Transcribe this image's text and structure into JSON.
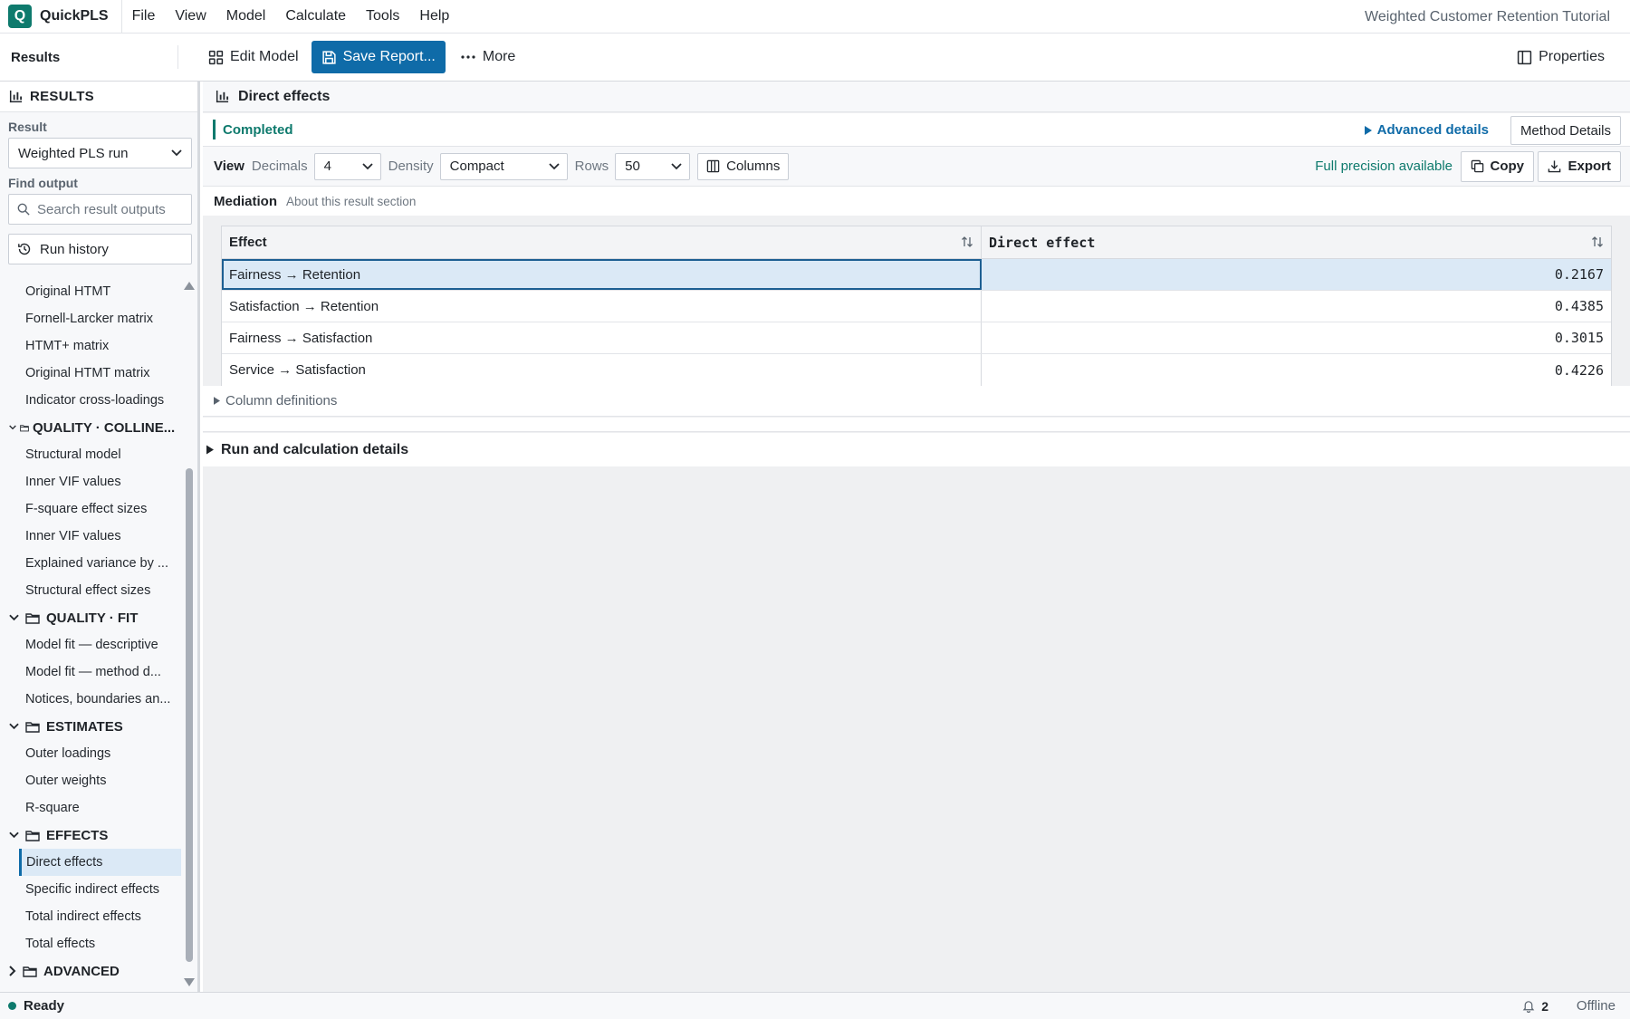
{
  "app": {
    "name": "QuickPLS",
    "logo_letter": "Q",
    "window_title": "Weighted Customer Retention Tutorial",
    "accent": "#0f6ba8",
    "success": "#0e7a6d"
  },
  "menu": [
    "File",
    "View",
    "Model",
    "Calculate",
    "Tools",
    "Help"
  ],
  "toolbar": {
    "title": "Results",
    "edit_model": "Edit Model",
    "save_report": "Save Report...",
    "more": "More",
    "properties": "Properties"
  },
  "sidebar": {
    "header": "RESULTS",
    "result_label": "Result",
    "result_value": "Weighted PLS run",
    "find_label": "Find output",
    "search_placeholder": "Search result outputs",
    "run_history": "Run history",
    "tree": [
      {
        "type": "item",
        "label": "Original HTMT"
      },
      {
        "type": "item",
        "label": "Fornell-Larcker matrix"
      },
      {
        "type": "item",
        "label": "HTMT+ matrix"
      },
      {
        "type": "item",
        "label": "Original HTMT matrix"
      },
      {
        "type": "item",
        "label": "Indicator cross-loadings"
      },
      {
        "type": "group",
        "label": "QUALITY · COLLINE...",
        "expanded": true,
        "small": true
      },
      {
        "type": "item",
        "label": "Structural model"
      },
      {
        "type": "item",
        "label": "Inner VIF values"
      },
      {
        "type": "item",
        "label": "F-square effect sizes"
      },
      {
        "type": "item",
        "label": "Inner VIF values"
      },
      {
        "type": "item",
        "label": "Explained variance by ..."
      },
      {
        "type": "item",
        "label": "Structural effect sizes"
      },
      {
        "type": "group",
        "label": "QUALITY · FIT",
        "expanded": true
      },
      {
        "type": "item",
        "label": "Model fit — descriptive"
      },
      {
        "type": "item",
        "label": "Model fit — method d..."
      },
      {
        "type": "item",
        "label": "Notices, boundaries an..."
      },
      {
        "type": "group",
        "label": "ESTIMATES",
        "expanded": true
      },
      {
        "type": "item",
        "label": "Outer loadings"
      },
      {
        "type": "item",
        "label": "Outer weights"
      },
      {
        "type": "item",
        "label": "R-square"
      },
      {
        "type": "group",
        "label": "EFFECTS",
        "expanded": true
      },
      {
        "type": "item",
        "label": "Direct effects",
        "active": true
      },
      {
        "type": "item",
        "label": "Specific indirect effects"
      },
      {
        "type": "item",
        "label": "Total indirect effects"
      },
      {
        "type": "item",
        "label": "Total effects"
      },
      {
        "type": "group",
        "label": "ADVANCED",
        "expanded": false
      }
    ]
  },
  "main": {
    "title": "Direct effects",
    "status": "Completed",
    "advanced_details": "Advanced details",
    "method_details": "Method Details",
    "view": {
      "label": "View",
      "decimals_label": "Decimals",
      "decimals_value": "4",
      "density_label": "Density",
      "density_value": "Compact",
      "rows_label": "Rows",
      "rows_value": "50",
      "columns": "Columns",
      "full_precision": "Full precision available",
      "copy": "Copy",
      "export": "Export"
    },
    "section": {
      "title": "Mediation",
      "about": "About this result section"
    },
    "table": {
      "headers": [
        "Effect",
        "Direct effect"
      ],
      "rows": [
        {
          "effect": "Fairness → Retention",
          "value": "0.2167"
        },
        {
          "effect": "Satisfaction → Retention",
          "value": "0.4385"
        },
        {
          "effect": "Fairness → Satisfaction",
          "value": "0.3015"
        },
        {
          "effect": "Service → Satisfaction",
          "value": "0.4226"
        }
      ]
    },
    "column_definitions": "Column definitions",
    "run_details": "Run and calculation details"
  },
  "footer": {
    "status": "Ready",
    "notifications": "2",
    "connection": "Offline"
  }
}
